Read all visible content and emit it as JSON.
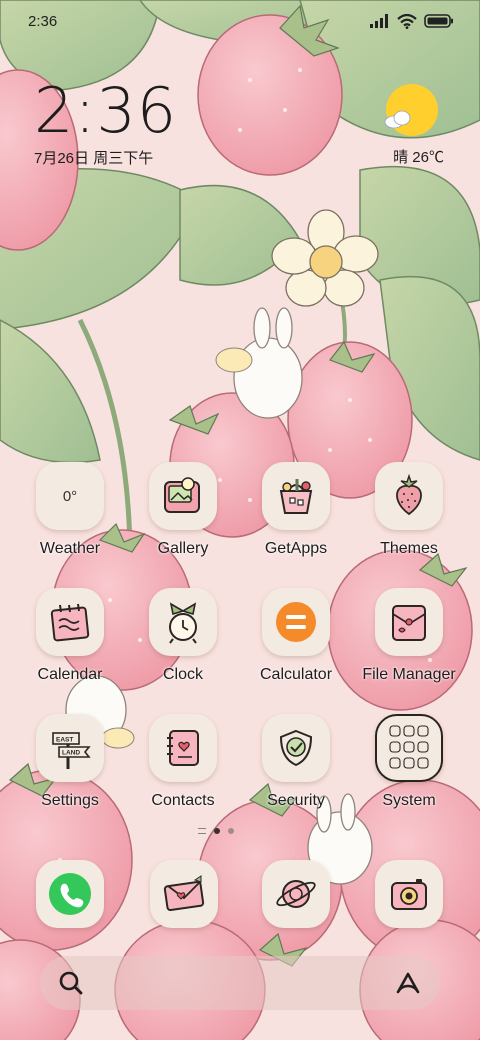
{
  "status_bar": {
    "time": "2:36",
    "icons": [
      "signal-icon",
      "wifi-icon",
      "battery-icon"
    ]
  },
  "clock_widget": {
    "time": "2:36",
    "date": "7月26日 周三下午"
  },
  "weather_widget": {
    "condition_icon": "sun-cloud-icon",
    "text": "晴 26℃"
  },
  "apps": [
    {
      "label": "Weather",
      "icon": "weather-icon",
      "value": "0°"
    },
    {
      "label": "Gallery",
      "icon": "gallery-icon"
    },
    {
      "label": "GetApps",
      "icon": "getapps-icon"
    },
    {
      "label": "Themes",
      "icon": "strawberry-icon"
    },
    {
      "label": "Calendar",
      "icon": "calendar-icon"
    },
    {
      "label": "Clock",
      "icon": "alarm-clock-icon"
    },
    {
      "label": "Calculator",
      "icon": "calculator-icon"
    },
    {
      "label": "File Manager",
      "icon": "folder-icon"
    },
    {
      "label": "Settings",
      "icon": "signpost-icon",
      "sign_text": [
        "EAST",
        "LAND"
      ]
    },
    {
      "label": "Contacts",
      "icon": "notebook-icon"
    },
    {
      "label": "Security",
      "icon": "shield-icon"
    },
    {
      "label": "System",
      "icon": "folder-grid-icon"
    }
  ],
  "dock": [
    {
      "name": "phone",
      "icon": "phone-icon"
    },
    {
      "name": "messages",
      "icon": "envelope-icon"
    },
    {
      "name": "browser",
      "icon": "planet-icon"
    },
    {
      "name": "camera",
      "icon": "camera-icon"
    }
  ],
  "search_bar": {
    "left_icon": "search-icon",
    "right_icon": "assistant-icon"
  },
  "page_indicator": {
    "pages": 2,
    "active": 1
  },
  "colors": {
    "background_pink": "#f6dcdc",
    "leaf_green": "#b9cc9e",
    "strawberry_pink": "#f2a9b3",
    "icon_cream": "#f3ebe1",
    "sun_yellow": "#ffcf2e",
    "calculator_orange": "#f58a2b",
    "phone_green": "#34c759"
  }
}
